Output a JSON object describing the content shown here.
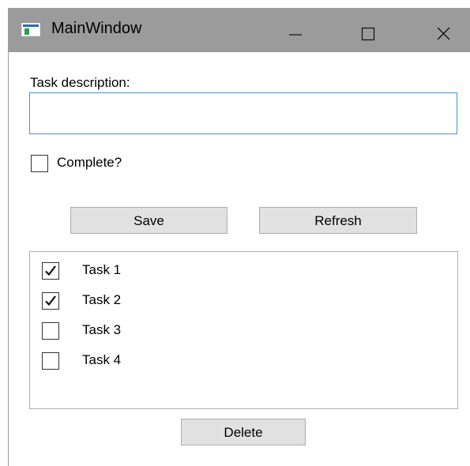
{
  "window": {
    "title": "MainWindow",
    "icon": "app-window-icon",
    "controls": [
      "minimize-icon",
      "maximize-icon",
      "close-icon"
    ]
  },
  "form": {
    "task_description_label": "Task description:",
    "task_description_value": "",
    "complete_label": "Complete?",
    "complete_checked": false,
    "save_label": "Save",
    "refresh_label": "Refresh",
    "delete_label": "Delete"
  },
  "tasks": [
    {
      "label": "Task 1",
      "checked": true
    },
    {
      "label": "Task 2",
      "checked": true
    },
    {
      "label": "Task 3",
      "checked": false
    },
    {
      "label": "Task 4",
      "checked": false
    }
  ],
  "colors": {
    "titlebar": "#9b9b9b",
    "input_focus_border": "#4a8fdf",
    "button_face": "#e1e1e1"
  }
}
